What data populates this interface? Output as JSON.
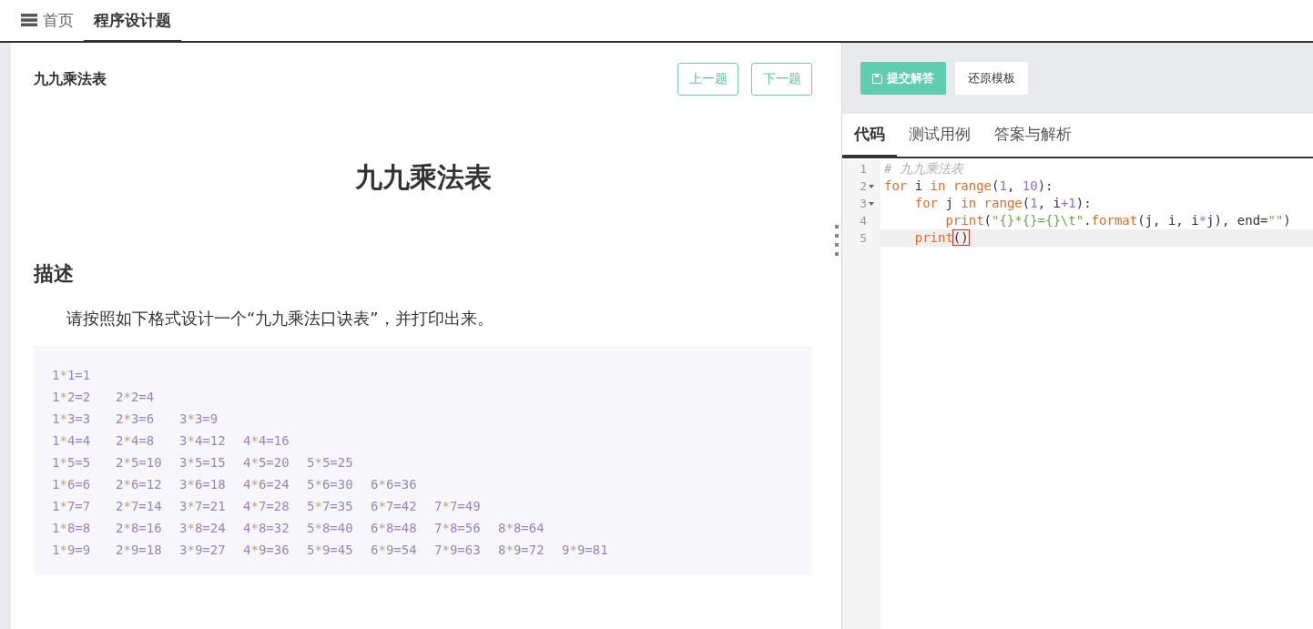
{
  "tabs": [
    {
      "label": "首页",
      "selected": false,
      "kind": "home"
    },
    {
      "label": "程序设计题",
      "selected": true,
      "kind": "plain"
    }
  ],
  "problem": {
    "title": "九九乘法表",
    "prev_button": "上一题",
    "next_button": "下一题",
    "heading": "九九乘法表",
    "section": "描述",
    "description": "请按照如下格式设计一个“九九乘法口诀表”，并打印出来。",
    "sample_output": [
      [
        "1*1=1"
      ],
      [
        "1*2=2",
        "2*2=4"
      ],
      [
        "1*3=3",
        "2*3=6",
        "3*3=9"
      ],
      [
        "1*4=4",
        "2*4=8",
        "3*4=12",
        "4*4=16"
      ],
      [
        "1*5=5",
        "2*5=10",
        "3*5=15",
        "4*5=20",
        "5*5=25"
      ],
      [
        "1*6=6",
        "2*6=12",
        "3*6=18",
        "4*6=24",
        "5*6=30",
        "6*6=36"
      ],
      [
        "1*7=7",
        "2*7=14",
        "3*7=21",
        "4*7=28",
        "5*7=35",
        "6*7=42",
        "7*7=49"
      ],
      [
        "1*8=8",
        "2*8=16",
        "3*8=24",
        "4*8=32",
        "5*8=40",
        "6*8=48",
        "7*8=56",
        "8*8=64"
      ],
      [
        "1*9=9",
        "2*9=18",
        "3*9=27",
        "4*9=36",
        "5*9=45",
        "6*9=54",
        "7*9=63",
        "8*9=72",
        "9*9=81"
      ]
    ]
  },
  "editor": {
    "submit_button": "提交解答",
    "reset_button": "还原模板",
    "tabs": [
      {
        "label": "代码",
        "selected": true
      },
      {
        "label": "测试用例",
        "selected": false
      },
      {
        "label": "答案与解析",
        "selected": false
      }
    ],
    "lines": [
      {
        "number": "1",
        "fold": false,
        "active": false,
        "tokens": [
          {
            "kind": "comment",
            "text": "# 九九乘法表"
          }
        ]
      },
      {
        "number": "2",
        "fold": true,
        "active": false,
        "tokens": [
          {
            "kind": "keyword",
            "text": "for"
          },
          {
            "kind": "plain",
            "text": " i "
          },
          {
            "kind": "keyword",
            "text": "in"
          },
          {
            "kind": "builtin",
            "text": " range"
          },
          {
            "kind": "plain",
            "text": "("
          },
          {
            "kind": "number",
            "text": "1"
          },
          {
            "kind": "plain",
            "text": ", "
          },
          {
            "kind": "number",
            "text": "10"
          },
          {
            "kind": "plain",
            "text": "):"
          }
        ]
      },
      {
        "number": "3",
        "fold": true,
        "active": false,
        "tokens": [
          {
            "kind": "keyword",
            "text": "    for"
          },
          {
            "kind": "plain",
            "text": " j "
          },
          {
            "kind": "keyword",
            "text": "in"
          },
          {
            "kind": "builtin",
            "text": " range"
          },
          {
            "kind": "plain",
            "text": "("
          },
          {
            "kind": "number",
            "text": "1"
          },
          {
            "kind": "plain",
            "text": ", i"
          },
          {
            "kind": "operator",
            "text": "+"
          },
          {
            "kind": "number",
            "text": "1"
          },
          {
            "kind": "plain",
            "text": "):"
          }
        ]
      },
      {
        "number": "4",
        "fold": false,
        "active": false,
        "tokens": [
          {
            "kind": "builtin",
            "text": "        print"
          },
          {
            "kind": "plain",
            "text": "("
          },
          {
            "kind": "string",
            "text": "\"{}*{}={}\\t\""
          },
          {
            "kind": "plain",
            "text": "."
          },
          {
            "kind": "builtin",
            "text": "format"
          },
          {
            "kind": "plain",
            "text": "(j, i, i"
          },
          {
            "kind": "operator",
            "text": "*"
          },
          {
            "kind": "plain",
            "text": "j), end="
          },
          {
            "kind": "string",
            "text": "\"\""
          },
          {
            "kind": "plain",
            "text": ")"
          }
        ]
      },
      {
        "number": "5",
        "fold": false,
        "active": true,
        "tokens": [
          {
            "kind": "builtin",
            "text": "    print"
          },
          {
            "kind": "bracket",
            "text": "()"
          }
        ]
      }
    ]
  }
}
